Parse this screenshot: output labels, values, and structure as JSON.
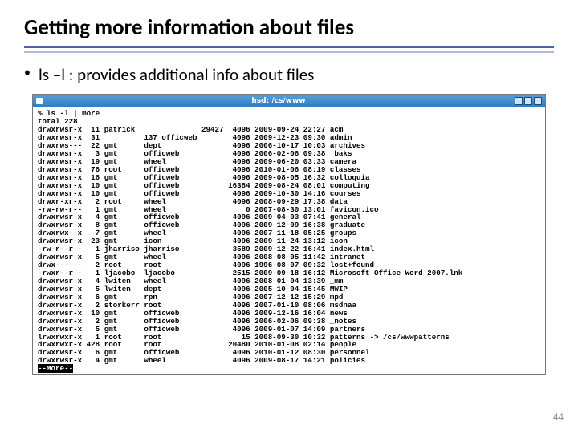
{
  "heading": "Getting more information about files",
  "bullet_text": "ls –l : provides additional info about files",
  "terminal": {
    "title": "hsd: /cs/www",
    "prompt": "% ls -l | more",
    "total_line": "total 228",
    "more_prompt": "--More--",
    "rows": [
      {
        "perm": "drwxrwsr-x",
        "lnk": "11",
        "owner": "patrick",
        "grp": "",
        "size": "29427",
        "msize": "4096",
        "date": "2009-09-24",
        "time": "22:27",
        "name": "acm"
      },
      {
        "perm": "drwxrwsr-x",
        "lnk": "31",
        "owner": "",
        "grp": "137 officweb",
        "size": "",
        "msize": "4096",
        "date": "2009-12-23",
        "time": "09:30",
        "name": "admin"
      },
      {
        "perm": "drwxrws---",
        "lnk": "22",
        "owner": "gmt",
        "grp": "dept",
        "size": "",
        "msize": "4096",
        "date": "2006-10-17",
        "time": "10:03",
        "name": "archives"
      },
      {
        "perm": "drwxrwsr-x",
        "lnk": "3",
        "owner": "gmt",
        "grp": "officweb",
        "size": "",
        "msize": "4096",
        "date": "2006-02-06",
        "time": "09:38",
        "name": "_baks"
      },
      {
        "perm": "drwxrwsr-x",
        "lnk": "19",
        "owner": "gmt",
        "grp": "wheel",
        "size": "",
        "msize": "4096",
        "date": "2009-06-20",
        "time": "03:33",
        "name": "camera"
      },
      {
        "perm": "drwxrwsr-x",
        "lnk": "76",
        "owner": "root",
        "grp": "officweb",
        "size": "",
        "msize": "4096",
        "date": "2010-01-06",
        "time": "08:19",
        "name": "classes"
      },
      {
        "perm": "drwxrwsr-x",
        "lnk": "16",
        "owner": "gmt",
        "grp": "officweb",
        "size": "",
        "msize": "4096",
        "date": "2009-08-05",
        "time": "16:32",
        "name": "colloquia"
      },
      {
        "perm": "drwxrwsr-x",
        "lnk": "10",
        "owner": "gmt",
        "grp": "officweb",
        "size": "",
        "msize": "16384",
        "date": "2009-08-24",
        "time": "08:01",
        "name": "computing"
      },
      {
        "perm": "drwxrwsr-x",
        "lnk": "10",
        "owner": "gmt",
        "grp": "officweb",
        "size": "",
        "msize": "4096",
        "date": "2009-10-30",
        "time": "14:16",
        "name": "courses"
      },
      {
        "perm": "drwxr-xr-x",
        "lnk": "2",
        "owner": "root",
        "grp": "wheel",
        "size": "",
        "msize": "4096",
        "date": "2008-09-29",
        "time": "17:38",
        "name": "data"
      },
      {
        "perm": "-rw-rw-r--",
        "lnk": "1",
        "owner": "gmt",
        "grp": "wheel",
        "size": "",
        "msize": "0",
        "date": "2007-08-30",
        "time": "13:01",
        "name": "favicon.ico"
      },
      {
        "perm": "drwxrwsr-x",
        "lnk": "4",
        "owner": "gmt",
        "grp": "officweb",
        "size": "",
        "msize": "4096",
        "date": "2009-04-03",
        "time": "07:41",
        "name": "general"
      },
      {
        "perm": "drwxrwsr-x",
        "lnk": "8",
        "owner": "gmt",
        "grp": "officweb",
        "size": "",
        "msize": "4096",
        "date": "2009-12-09",
        "time": "16:38",
        "name": "graduate"
      },
      {
        "perm": "drwxrwx--x",
        "lnk": "7",
        "owner": "gmt",
        "grp": "wheel",
        "size": "",
        "msize": "4096",
        "date": "2007-11-18",
        "time": "05:25",
        "name": "groups"
      },
      {
        "perm": "drwxrwsr-x",
        "lnk": "23",
        "owner": "gmt",
        "grp": "icon",
        "size": "",
        "msize": "4096",
        "date": "2009-11-24",
        "time": "13:12",
        "name": "icon"
      },
      {
        "perm": "-rw-r--r--",
        "lnk": "1",
        "owner": "jharriso",
        "grp": "jharriso",
        "size": "",
        "msize": "3589",
        "date": "2009-12-22",
        "time": "16:41",
        "name": "index.html"
      },
      {
        "perm": "drwxrwsr-x",
        "lnk": "5",
        "owner": "gmt",
        "grp": "wheel",
        "size": "",
        "msize": "4096",
        "date": "2008-08-05",
        "time": "11:42",
        "name": "intranet"
      },
      {
        "perm": "drwx------",
        "lnk": "2",
        "owner": "root",
        "grp": "root",
        "size": "",
        "msize": "4096",
        "date": "1996-08-07",
        "time": "09:32",
        "name": "lost+found"
      },
      {
        "perm": "-rwxr--r--",
        "lnk": "1",
        "owner": "ljacobo",
        "grp": "ljacobo",
        "size": "",
        "msize": "2515",
        "date": "2009-09-18",
        "time": "16:12",
        "name": "Microsoft Office Word 2007.lnk"
      },
      {
        "perm": "drwxrwsr-x",
        "lnk": "4",
        "owner": "lwiten",
        "grp": "wheel",
        "size": "",
        "msize": "4096",
        "date": "2008-01-04",
        "time": "13:39",
        "name": "_mm"
      },
      {
        "perm": "drwxrwsr-x",
        "lnk": "5",
        "owner": "lwiten",
        "grp": "dept",
        "size": "",
        "msize": "4096",
        "date": "2005-10-04",
        "time": "15:45",
        "name": "MWIP"
      },
      {
        "perm": "drwxrwsr-x",
        "lnk": "6",
        "owner": "gmt",
        "grp": "rpn",
        "size": "",
        "msize": "4096",
        "date": "2007-12-12",
        "time": "15:29",
        "name": "mpd"
      },
      {
        "perm": "drwxrwsr-x",
        "lnk": "2",
        "owner": "storkerr",
        "grp": "root",
        "size": "",
        "msize": "4096",
        "date": "2007-01-10",
        "time": "08:06",
        "name": "msdnaa"
      },
      {
        "perm": "drwxrwsr-x",
        "lnk": "10",
        "owner": "gmt",
        "grp": "officweb",
        "size": "",
        "msize": "4096",
        "date": "2009-12-16",
        "time": "16:04",
        "name": "news"
      },
      {
        "perm": "drwxrwsr-x",
        "lnk": "2",
        "owner": "gmt",
        "grp": "officweb",
        "size": "",
        "msize": "4096",
        "date": "2006-02-06",
        "time": "09:38",
        "name": "_notes"
      },
      {
        "perm": "drwxrwsr-x",
        "lnk": "5",
        "owner": "gmt",
        "grp": "officweb",
        "size": "",
        "msize": "4096",
        "date": "2009-01-07",
        "time": "14:09",
        "name": "partners"
      },
      {
        "perm": "lrwxrwxr-x",
        "lnk": "1",
        "owner": "root",
        "grp": "root",
        "size": "",
        "msize": "15",
        "date": "2008-09-30",
        "time": "10:32",
        "name": "patterns -> /cs/wwwpatterns"
      },
      {
        "perm": "drwxrwxr-x",
        "lnk": "428",
        "owner": "root",
        "grp": "root",
        "size": "",
        "msize": "20480",
        "date": "2010-01-08",
        "time": "02:14",
        "name": "people"
      },
      {
        "perm": "drwxrwsr-x",
        "lnk": "6",
        "owner": "gmt",
        "grp": "officweb",
        "size": "",
        "msize": "4096",
        "date": "2010-01-12",
        "time": "08:30",
        "name": "personnel"
      },
      {
        "perm": "drwxrwsr-x",
        "lnk": "4",
        "owner": "gmt",
        "grp": "wheel",
        "size": "",
        "msize": "4096",
        "date": "2009-08-17",
        "time": "14:21",
        "name": "policies"
      }
    ]
  },
  "page_number": "44"
}
